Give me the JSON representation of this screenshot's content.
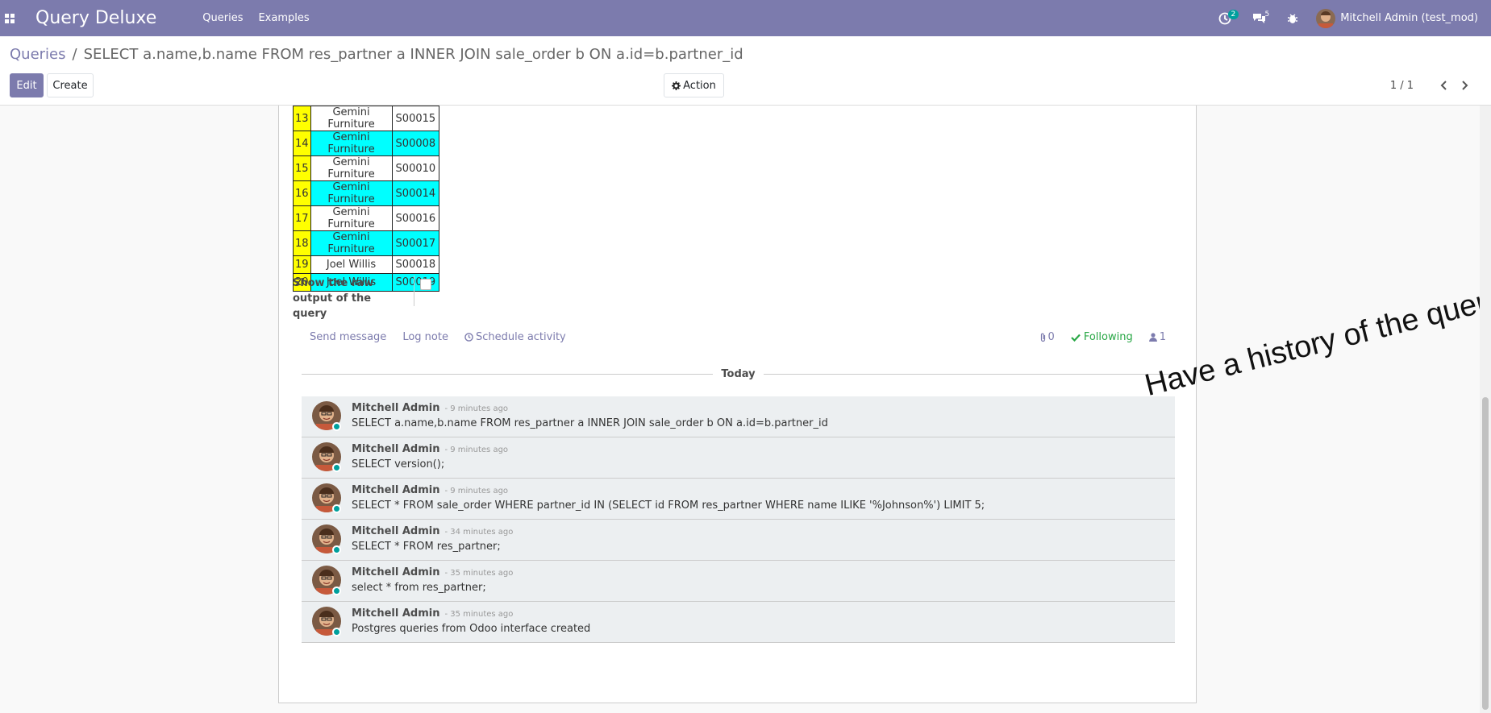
{
  "navbar": {
    "brand": "Query Deluxe",
    "menu": [
      "Queries",
      "Examples"
    ],
    "activity_count": "2",
    "messages_count": "5",
    "user": "Mitchell Admin (test_mod)"
  },
  "breadcrumb": {
    "parent": "Queries",
    "separator": "/",
    "current": "SELECT a.name,b.name FROM res_partner a INNER JOIN sale_order b ON a.id=b.partner_id"
  },
  "buttons": {
    "edit": "Edit",
    "create": "Create",
    "action": "Action"
  },
  "pager": {
    "value": "1 / 1"
  },
  "result_rows": [
    {
      "n": "13",
      "name": "Gemini Furniture",
      "ref": "S00015",
      "highlight": false
    },
    {
      "n": "14",
      "name": "Gemini Furniture",
      "ref": "S00008",
      "highlight": true
    },
    {
      "n": "15",
      "name": "Gemini Furniture",
      "ref": "S00010",
      "highlight": false
    },
    {
      "n": "16",
      "name": "Gemini Furniture",
      "ref": "S00014",
      "highlight": true
    },
    {
      "n": "17",
      "name": "Gemini Furniture",
      "ref": "S00016",
      "highlight": false
    },
    {
      "n": "18",
      "name": "Gemini Furniture",
      "ref": "S00017",
      "highlight": true
    },
    {
      "n": "19",
      "name": "Joel Willis",
      "ref": "S00018",
      "highlight": false
    },
    {
      "n": "20",
      "name": "Joel Willis",
      "ref": "S00019",
      "highlight": true
    }
  ],
  "raw_output": {
    "label": "Show the raw output of the query",
    "checked": false
  },
  "chatter": {
    "send_message": "Send message",
    "log_note": "Log note",
    "schedule_activity": "Schedule activity",
    "attachments": "0",
    "following": "Following",
    "followers": "1",
    "today": "Today",
    "messages": [
      {
        "author": "Mitchell Admin",
        "time": "- 9 minutes ago",
        "body": "SELECT a.name,b.name FROM res_partner a INNER JOIN sale_order b ON a.id=b.partner_id"
      },
      {
        "author": "Mitchell Admin",
        "time": "- 9 minutes ago",
        "body": "SELECT version();"
      },
      {
        "author": "Mitchell Admin",
        "time": "- 9 minutes ago",
        "body": "SELECT * FROM sale_order WHERE partner_id IN (SELECT id FROM res_partner WHERE name ILIKE '%Johnson%') LIMIT 5;"
      },
      {
        "author": "Mitchell Admin",
        "time": "- 34 minutes ago",
        "body": "SELECT * FROM res_partner;"
      },
      {
        "author": "Mitchell Admin",
        "time": "- 35 minutes ago",
        "body": "select * from res_partner;"
      },
      {
        "author": "Mitchell Admin",
        "time": "- 35 minutes ago",
        "body": "Postgres queries from Odoo interface created"
      }
    ]
  },
  "overlay": "Have a history of the queries",
  "colors": {
    "brand": "#7c7bad",
    "row_number": "#ffff00",
    "row_highlight": "#00ffff",
    "online": "#00a09d",
    "following": "#28a745"
  }
}
